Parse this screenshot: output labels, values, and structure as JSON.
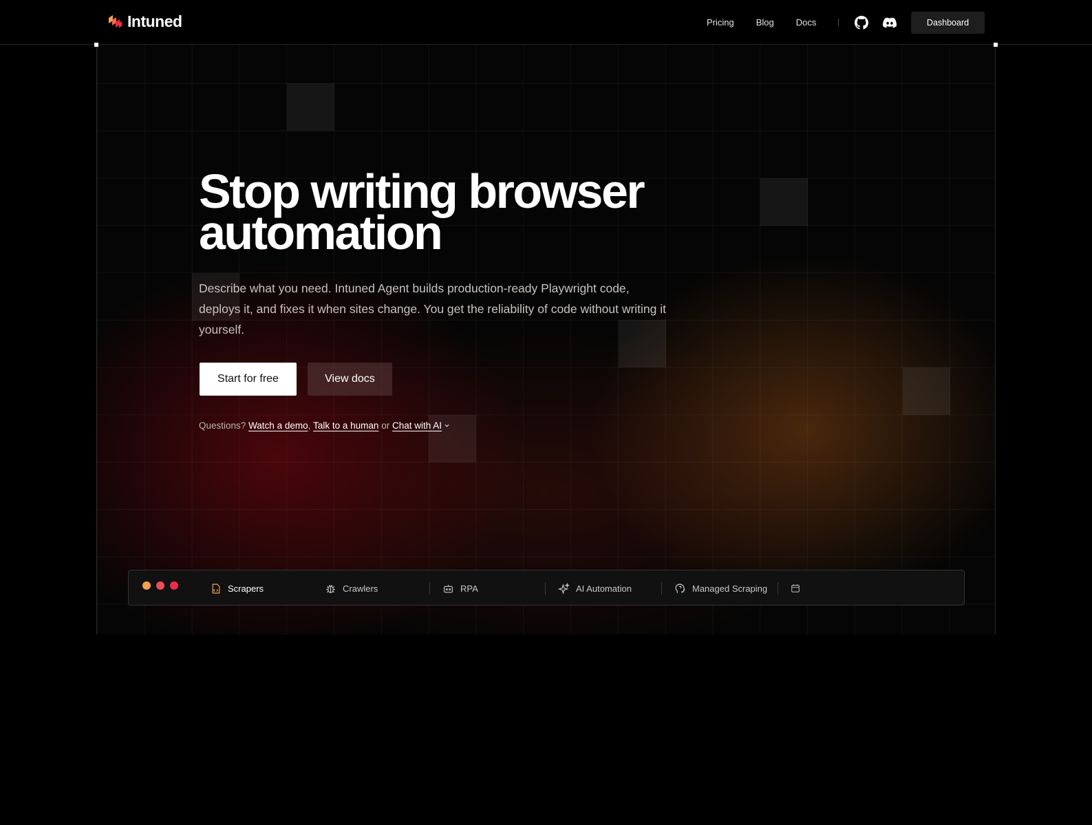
{
  "header": {
    "logo_text": "Intuned",
    "nav": [
      {
        "label": "Pricing"
      },
      {
        "label": "Blog"
      },
      {
        "label": "Docs"
      }
    ],
    "icons": [
      "github-icon",
      "discord-icon"
    ],
    "dashboard_label": "Dashboard"
  },
  "hero": {
    "title_line1": "Stop writing browser",
    "title_line2": "automation",
    "subtitle": "Describe what you need. Intuned Agent builds production-ready Playwright code, deploys it, and fixes it when sites change. You get the reliability of code without writing it yourself.",
    "primary_cta": "Start for free",
    "secondary_cta": "View docs",
    "questions_prefix": "Questions?",
    "link_demo": "Watch a demo",
    "comma": ",",
    "link_human": "Talk to a human",
    "or_text": "or",
    "link_chat": "Chat with AI"
  },
  "tabbar": {
    "window_dots": [
      "#f6a24b",
      "#ef4c5a",
      "#ee2b4a"
    ],
    "tabs": [
      {
        "label": "Scrapers",
        "icon": "file-code-icon",
        "active": true
      },
      {
        "label": "Crawlers",
        "icon": "bug-icon",
        "active": false
      },
      {
        "label": "RPA",
        "icon": "robot-icon",
        "active": false
      },
      {
        "label": "AI Automation",
        "icon": "sparkles-icon",
        "active": false
      },
      {
        "label": "Managed Scraping",
        "icon": "head-icon",
        "active": false
      }
    ],
    "extra_icon": "calendar-icon"
  },
  "colors": {
    "background": "#000000",
    "accent_orange": "#f6a24b",
    "accent_red": "#ee2b4a"
  }
}
